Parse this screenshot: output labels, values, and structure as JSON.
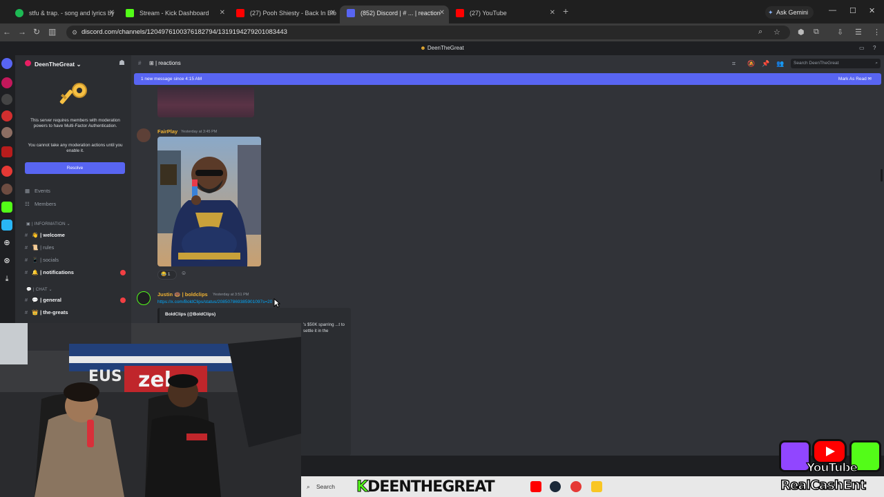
{
  "browser": {
    "tabs": [
      {
        "title": "stfu & trap. - song and lyrics by",
        "color": "#1db954"
      },
      {
        "title": "Stream - Kick Dashboard",
        "color": "#53fc18"
      },
      {
        "title": "(27) Pooh Shiesty - Back In Blo",
        "color": "#ff0000"
      },
      {
        "title": "(852) Discord | # ... | reaction",
        "color": "#5865f2"
      },
      {
        "title": "(27) YouTube",
        "color": "#ff0000"
      }
    ],
    "ask_gemini": "Ask Gemini",
    "url": "discord.com/channels/1204976100376182794/1319194279201083443"
  },
  "discord": {
    "window_title": "DeenTheGreat",
    "server_name": "DeenTheGreat",
    "mfa_notice": "This server requires members with moderation powers to have Multi-Factor Authentication.",
    "mfa_notice2": "You cannot take any moderation actions until you enable it.",
    "resolve_label": "Resolve",
    "nav": [
      {
        "label": "Events",
        "icon": "calendar-icon"
      },
      {
        "label": "Members",
        "icon": "members-icon"
      }
    ],
    "categories": {
      "information": "INFORMATION",
      "chat": "CHAT"
    },
    "channels_info": [
      {
        "name": "welcome",
        "emoji": "👋",
        "unread": true,
        "badge": false
      },
      {
        "name": "rules",
        "emoji": "📜",
        "unread": false,
        "badge": false
      },
      {
        "name": "socials",
        "emoji": "📱",
        "unread": false,
        "badge": false
      },
      {
        "name": "notifications",
        "emoji": "🔔",
        "unread": true,
        "badge": true
      }
    ],
    "channels_chat": [
      {
        "name": "general",
        "emoji": "💬",
        "unread": true,
        "badge": true
      },
      {
        "name": "the-greats",
        "emoji": "👑",
        "unread": true,
        "badge": false
      }
    ],
    "channel": {
      "name": "reactions",
      "separator": "|"
    },
    "search_placeholder": "Search DeenTheGreat",
    "new_message_bar": "1 new message since 4:15 AM",
    "mark_as_read": "Mark As Read",
    "messages": [
      {
        "author": "FairPlay",
        "author_color": "#f0b232",
        "timestamp": "Yesterday at 3:45 PM",
        "reaction_emoji": "😂",
        "reaction_count": "1"
      },
      {
        "author": "Justin 🍩 | boldclips",
        "author_color": "#f0b232",
        "timestamp": "Yesterday at 3:51 PM",
        "link": "https://x.com/BoldClips/status/208507869385901097s=20",
        "embed_author": "BoldClips (@BoldClips)",
        "embed_text": "'s $50K sparring ...t to settle it in the"
      }
    ]
  },
  "stream_overlay": {
    "taskbar_search": "Search",
    "channel_name": "DEENTHEGREAT",
    "youtube_label": "YouTube",
    "brand": "RealCashEnt"
  }
}
